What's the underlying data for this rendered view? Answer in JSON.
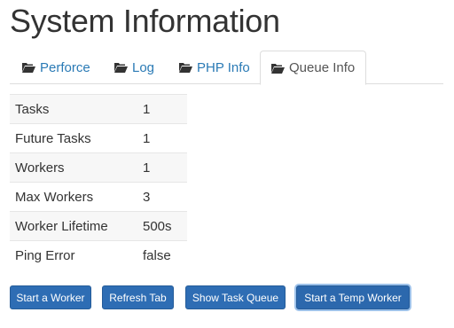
{
  "page": {
    "title": "System Information"
  },
  "tabs": [
    {
      "label": "Perforce",
      "icon": "folder-open-icon"
    },
    {
      "label": "Log",
      "icon": "folder-open-icon"
    },
    {
      "label": "PHP Info",
      "icon": "folder-open-icon"
    },
    {
      "label": "Queue Info",
      "icon": "folder-open-icon",
      "active": true
    }
  ],
  "queue_info": {
    "rows": [
      {
        "label": "Tasks",
        "value": "1"
      },
      {
        "label": "Future Tasks",
        "value": "1"
      },
      {
        "label": "Workers",
        "value": "1"
      },
      {
        "label": "Max Workers",
        "value": "3"
      },
      {
        "label": "Worker Lifetime",
        "value": "500s"
      },
      {
        "label": "Ping Error",
        "value": "false"
      }
    ]
  },
  "buttons": {
    "start_worker": "Start a Worker",
    "refresh_tab": "Refresh Tab",
    "show_task_queue": "Show Task Queue",
    "start_temp_worker": "Start a Temp Worker"
  },
  "colors": {
    "link": "#2a7ab5",
    "button": "#2e6db4",
    "focus_ring": "#9ec2ea"
  }
}
